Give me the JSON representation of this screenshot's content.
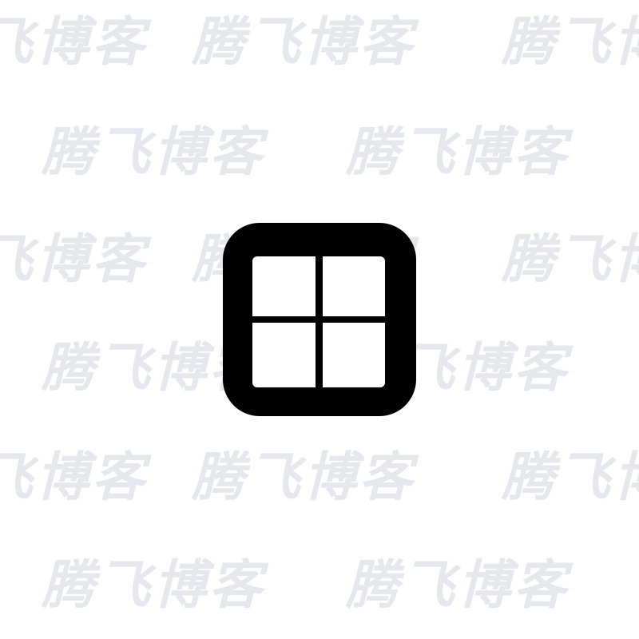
{
  "watermark": {
    "text": "腾飞博客",
    "color": "#e7e8ee"
  },
  "icon": {
    "name": "window-grid-icon",
    "frame_color": "#000000",
    "pane_color": "#ffffff"
  }
}
